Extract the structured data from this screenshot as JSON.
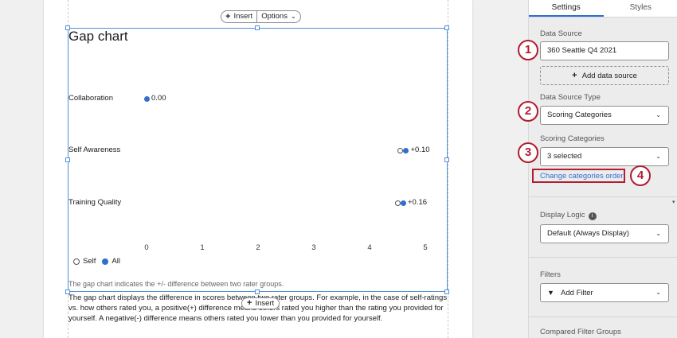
{
  "editor": {
    "toolbar": {
      "insert_label": "Insert",
      "options_label": "Options"
    },
    "insert_bottom_label": "Insert"
  },
  "widget": {
    "title": "Gap chart",
    "caption": "The gap chart indicates the +/- difference between two rater groups.",
    "description": "The gap chart displays the difference in scores between two rater groups. For example, in the case of self-ratings vs. how others rated you, a positive(+) difference means others rated you higher than the rating you provided for yourself. A negative(-) difference means others rated you lower than you provided for yourself."
  },
  "chart_data": {
    "type": "scatter",
    "categories": [
      "Collaboration",
      "Self Awareness",
      "Training Quality"
    ],
    "series": [
      {
        "name": "Self",
        "values": [
          null,
          4.55,
          4.5
        ]
      },
      {
        "name": "All",
        "values": [
          0.0,
          4.65,
          4.6
        ]
      }
    ],
    "value_labels": [
      "0.00",
      "+0.10",
      "+0.16"
    ],
    "x_ticks": [
      "0",
      "1",
      "2",
      "3",
      "4",
      "5"
    ],
    "xlim": [
      0,
      5
    ],
    "legend": "bottom-left",
    "colors": {
      "self": "#ffffff",
      "all": "#2f6fd0"
    }
  },
  "panel": {
    "tabs": [
      "Settings",
      "Styles"
    ],
    "data_source": {
      "label": "Data Source",
      "value": "360 Seattle Q4 2021",
      "add_label": "Add data source"
    },
    "data_source_type": {
      "label": "Data Source Type",
      "value": "Scoring Categories"
    },
    "scoring_categories": {
      "label": "Scoring Categories",
      "value": "3 selected",
      "link": "Change categories order"
    },
    "display_logic": {
      "label": "Display Logic",
      "value": "Default (Always Display)"
    },
    "filters": {
      "label": "Filters",
      "value": "Add Filter"
    },
    "compared_filter_groups": {
      "label": "Compared Filter Groups"
    }
  },
  "callouts": [
    "1",
    "2",
    "3",
    "4"
  ],
  "accent_color": "#2f6fd0",
  "callout_color": "#b01e2f"
}
